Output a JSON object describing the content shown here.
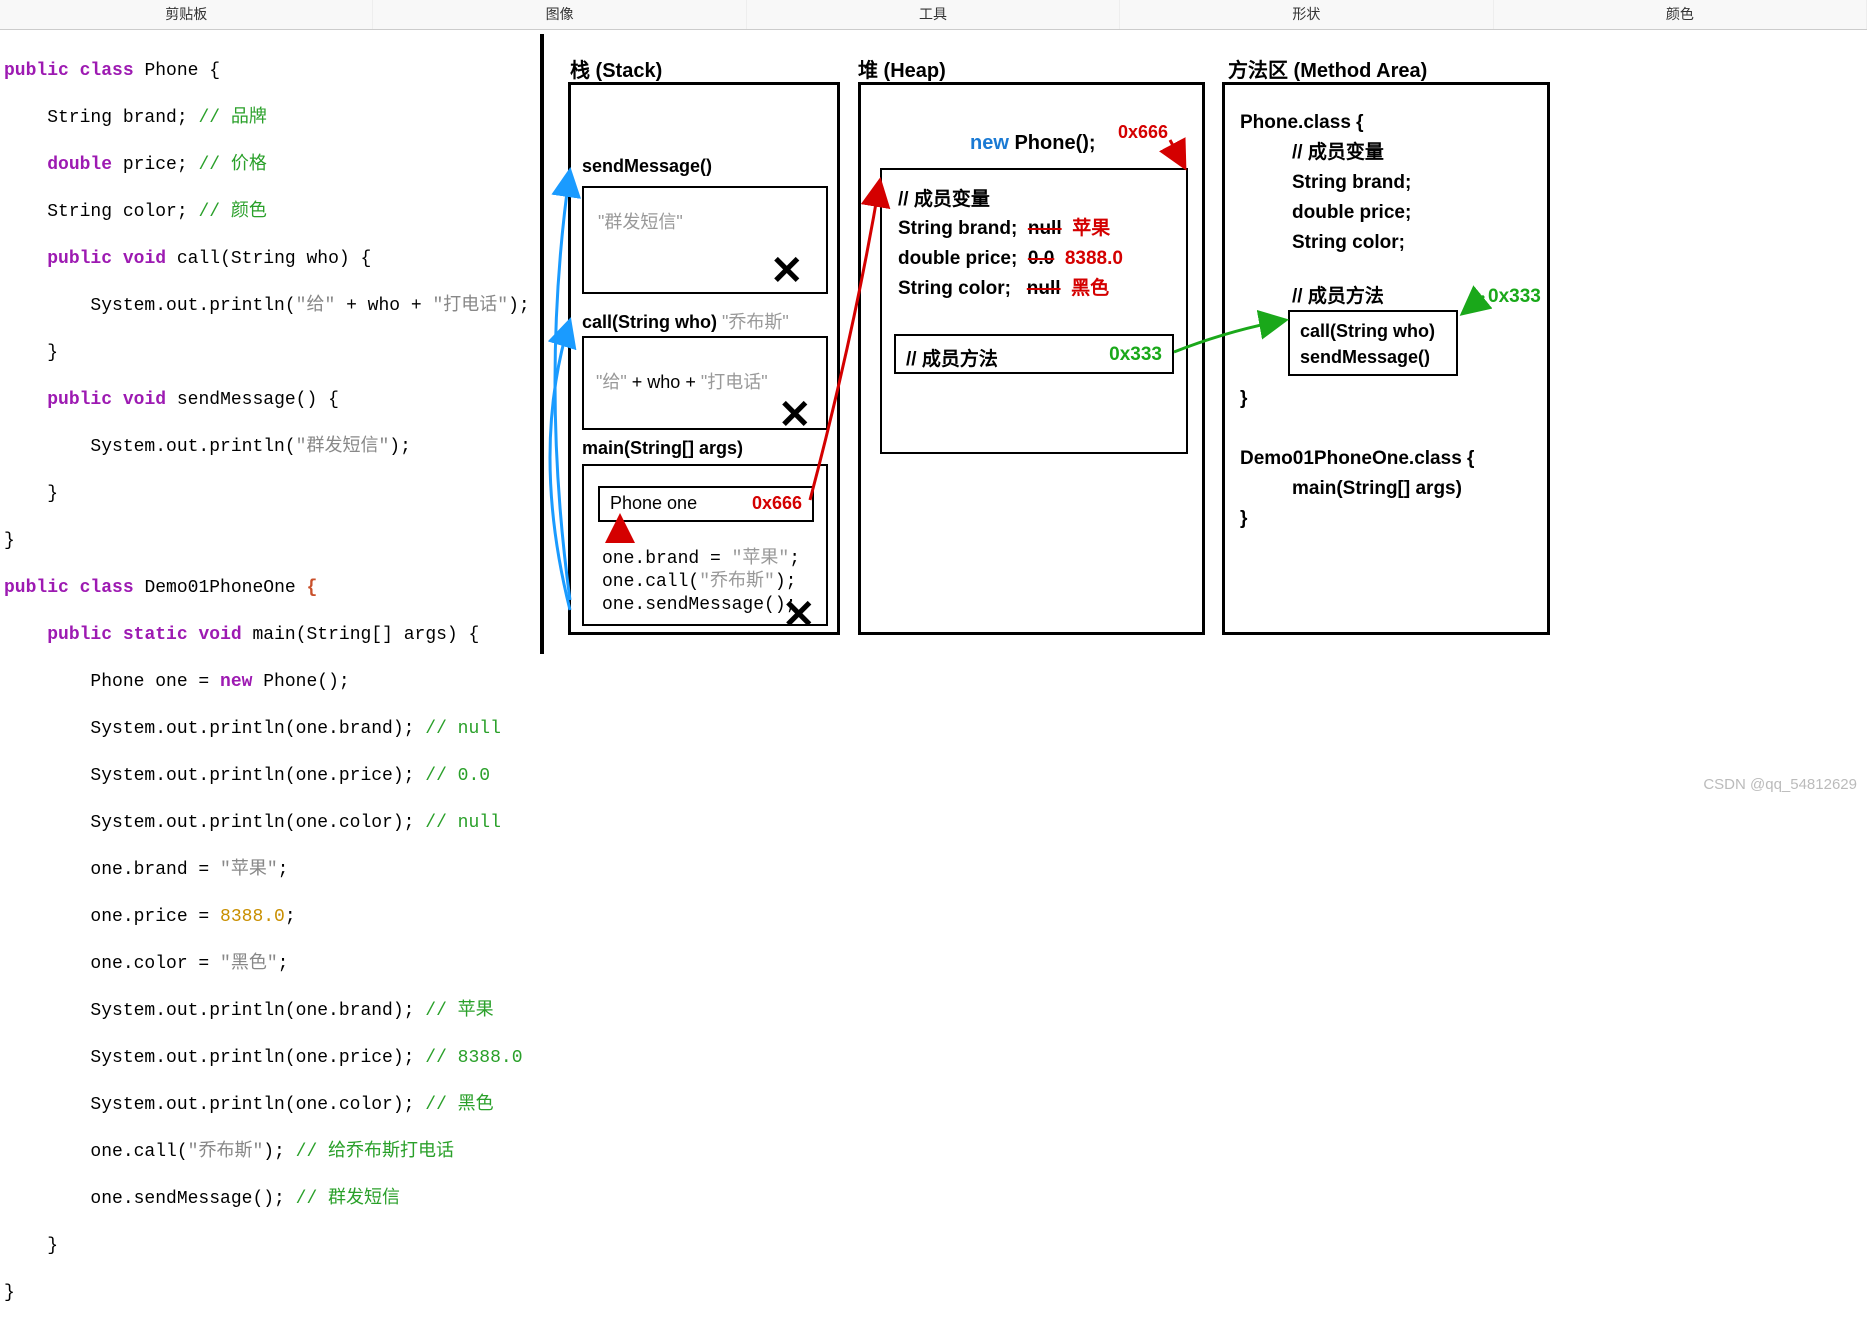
{
  "toolbar": {
    "items": [
      "剪贴板",
      "图像",
      "工具",
      "形状",
      "颜色"
    ]
  },
  "code": {
    "l1a": "public",
    "l1b": "class",
    "l1c": " Phone {",
    "l2a": "    String brand; ",
    "l2b": "// 品牌",
    "l3a": "    ",
    "l3b": "double",
    "l3c": " price; ",
    "l3d": "// 价格",
    "l4a": "    String color; ",
    "l4b": "// 颜色",
    "l5a": "    ",
    "l5b": "public",
    "l5c": " ",
    "l5d": "void",
    "l5e": " call(String who) {",
    "l6a": "        System.out.println(",
    "l6b": "\"给\"",
    "l6c": " + who + ",
    "l6d": "\"打电话\"",
    "l6e": ");",
    "l7": "    }",
    "l8a": "    ",
    "l8b": "public",
    "l8c": " ",
    "l8d": "void",
    "l8e": " sendMessage() {",
    "l9a": "        System.out.println(",
    "l9b": "\"群发短信\"",
    "l9c": ");",
    "l10": "    }",
    "l11": "}",
    "l12a": "public",
    "l12b": "class",
    "l12c": " Demo01PhoneOne ",
    "l12d": "{",
    "l13a": "    ",
    "l13b": "public",
    "l13c": " ",
    "l13d": "static",
    "l13e": " ",
    "l13f": "void",
    "l13g": " main(String[] args) {",
    "l14a": "        Phone one = ",
    "l14b": "new",
    "l14c": " Phone();",
    "l15a": "        System.out.println(one.brand); ",
    "l15b": "// null",
    "l16a": "        System.out.println(one.price); ",
    "l16b": "// 0.0",
    "l17a": "        System.out.println(one.color); ",
    "l17b": "// null",
    "l18a": "        one.brand = ",
    "l18b": "\"苹果\"",
    "l18c": ";",
    "l19a": "        one.price = ",
    "l19b": "8388.0",
    "l19c": ";",
    "l20a": "        one.color = ",
    "l20b": "\"黑色\"",
    "l20c": ";",
    "l21a": "        System.out.println(one.brand); ",
    "l21b": "// 苹果",
    "l22a": "        System.out.println(one.price); ",
    "l22b": "// 8388.0",
    "l23a": "        System.out.println(one.color); ",
    "l23b": "// 黑色",
    "l24a": "        one.call(",
    "l24b": "\"乔布斯\"",
    "l24c": "); ",
    "l24d": "// 给乔布斯打电话",
    "l25a": "        one.sendMessage(); ",
    "l25b": "// 群发短信",
    "l26": "    }",
    "l27": "}"
  },
  "stack": {
    "title": "栈  (Stack)",
    "send_label": "sendMessage()",
    "send_body": "\"群发短信\"",
    "call_label": "call(String who)",
    "call_arg": "\"乔布斯\"",
    "call_body_a": "\"给\"",
    "call_body_b": " + who + ",
    "call_body_c": "\"打电话\"",
    "main_label": "main(String[] args)",
    "phone_var": "Phone  one",
    "phone_addr": "0x666",
    "m1a": "one.brand = ",
    "m1b": "\"苹果\"",
    "m1c": ";",
    "m2a": "one.call(",
    "m2b": "\"乔布斯\"",
    "m2c": ");",
    "m3": "one.sendMessage();"
  },
  "heap": {
    "title": "堆  (Heap)",
    "new_kw": "new",
    "new_rest": " Phone();",
    "addr": "0x666",
    "fields_title": "// 成员变量",
    "f1": "String brand;",
    "f1old": "null",
    "f1new": "苹果",
    "f2": "double price;",
    "f2old": "0.0",
    "f2new": "8388.0",
    "f3": "String color;",
    "f3old": "null",
    "f3new": "黑色",
    "methods_title": "// 成员方法",
    "methods_addr": "0x333"
  },
  "method_area": {
    "title": "方法区  (Method Area)",
    "p_header": "Phone.class {",
    "p_c1": "// 成员变量",
    "p_c2": "String brand;",
    "p_c3": "double price;",
    "p_c4": "String color;",
    "p_m_title": "// 成员方法",
    "p_m1": "call(String who)",
    "p_m2": "sendMessage()",
    "p_close": "}",
    "d_header": "Demo01PhoneOne.class {",
    "d_m1": "main(String[] args)",
    "d_close": "}",
    "addr": "0x333"
  },
  "watermark": "CSDN @qq_54812629"
}
